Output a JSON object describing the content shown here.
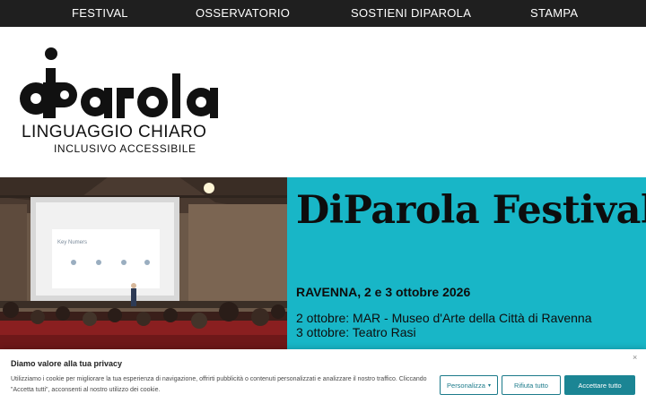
{
  "nav": {
    "festival": "FESTIVAL",
    "osservatorio": "OSSERVATORIO",
    "sostieni": "SOSTIENI DIPAROLA",
    "stampa": "STAMPA"
  },
  "logo": {
    "line1": "LINGUAGGIO CHIARO",
    "line2": "INCLUSIVO ACCESSIBILE"
  },
  "hero": {
    "title": "DiParola Festival",
    "city_date": "RAVENNA, 2 e 3 ottobre 2026",
    "day1": "2 ottobre: MAR - Museo d'Arte della Città di Ravenna",
    "day2": "3 ottobre: Teatro Rasi",
    "slide_text": "Key Numers",
    "panel_color": "#18b6c7"
  },
  "cookie": {
    "title": "Diamo valore alla tua privacy",
    "text": "Utilizziamo i cookie per migliorare la tua esperienza di navigazione, offrirti pubblicità o contenuti personalizzati e analizzare il nostro traffico. Cliccando \"Accetta tutti\", acconsenti al nostro utilizzo dei cookie.",
    "customize_label": "Personalizza",
    "reject_label": "Rifiuta tutto",
    "accept_label": "Accettare tutto",
    "close_glyph": "×",
    "accent_color": "#1b8594"
  }
}
